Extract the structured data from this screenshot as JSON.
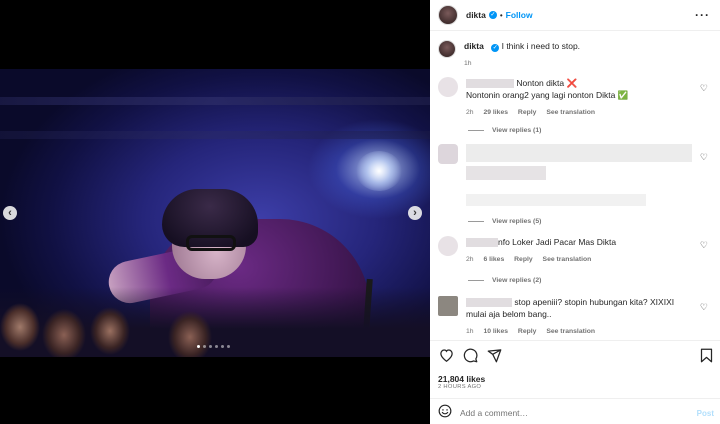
{
  "post": {
    "username": "dikta",
    "follow_label": "Follow",
    "more_icon": "more-horizontal-icon",
    "separator": "•"
  },
  "caption": {
    "username": "dikta",
    "text": "I think i need to stop.",
    "time": "1h"
  },
  "comments": [
    {
      "text_head": "Nonton dikta ❌",
      "text_tail": "Nontonin orang2 yang lagi nonton Dikta ✅",
      "time": "2h",
      "likes": "29 likes",
      "reply": "Reply",
      "translate": "See translation",
      "view_replies": "View replies (1)"
    },
    {
      "view_replies": "View replies (5)"
    },
    {
      "text_head": "nfo Loker Jadi Pacar Mas Dikta",
      "time": "2h",
      "likes": "6 likes",
      "reply": "Reply",
      "translate": "See translation",
      "view_replies": "View replies (2)"
    },
    {
      "text_head": "stop apeniii? stopin hubungan kita? XIXIXI mulai aja belom bang..",
      "time": "1h",
      "likes": "10 likes",
      "reply": "Reply",
      "translate": "See translation"
    }
  ],
  "actions": {
    "like_icon": "heart-icon",
    "comment_icon": "comment-icon",
    "share_icon": "send-icon",
    "save_icon": "bookmark-icon"
  },
  "stats": {
    "likes": "21,804 likes",
    "time_ago": "2 HOURS AGO"
  },
  "add_comment": {
    "emoji_icon": "emoji-icon",
    "placeholder": "Add a comment…",
    "post_label": "Post"
  },
  "carousel": {
    "slide_count": 6,
    "current_index": 0
  },
  "colors": {
    "accent": "#0095f6",
    "post_disabled": "#b2dffc",
    "muted_text": "#737373"
  }
}
